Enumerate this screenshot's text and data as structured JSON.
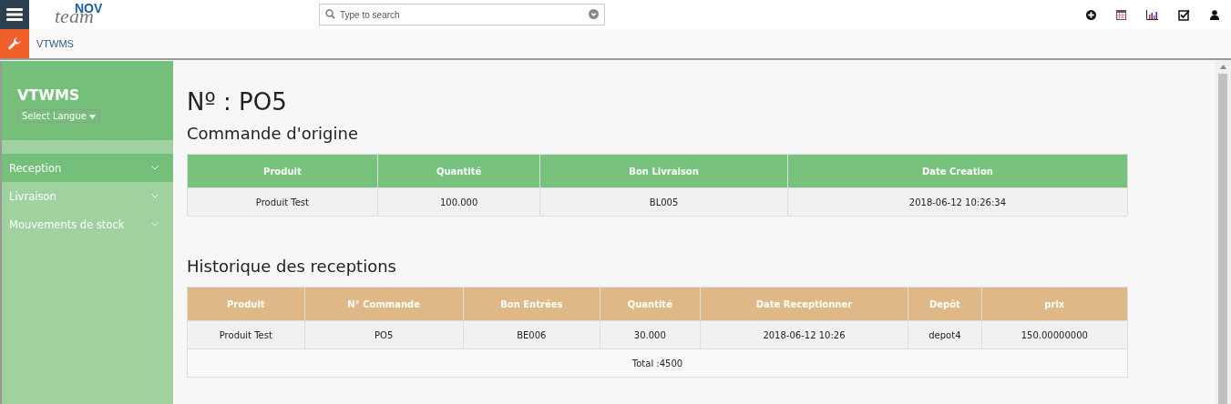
{
  "logo": {
    "top": "NOV",
    "bottom": "team"
  },
  "search": {
    "placeholder": "Type to search"
  },
  "toolbar_icons": [
    {
      "kind": "add"
    },
    {
      "kind": "calendar"
    },
    {
      "kind": "chart"
    },
    {
      "kind": "task"
    },
    {
      "kind": "user"
    }
  ],
  "breadcrumb": "VTWMS",
  "sidebar": {
    "title": "VTWMS",
    "language_select": "Select Langue",
    "items": [
      {
        "label": "Reception",
        "selected": true
      },
      {
        "label": "Livraison",
        "selected": false
      },
      {
        "label": "Mouvements de stock",
        "selected": false
      }
    ]
  },
  "page_title": "Nº : PO5",
  "order": {
    "heading": "Commande d'origine",
    "columns": [
      "Produit",
      "Quantité",
      "Bon Livraison",
      "Date Creation"
    ],
    "rows": [
      [
        "Produit Test",
        "100.000",
        "BL005",
        "2018-06-12 10:26:34"
      ]
    ]
  },
  "receptions": {
    "heading": "Historique des receptions",
    "columns": [
      "Produit",
      "N° Commande",
      "Bon Entrées",
      "Quantité",
      "Date Receptionner",
      "Depôt",
      "prix"
    ],
    "rows": [
      [
        "Produit Test",
        "PO5",
        "BE006",
        "30.000",
        "2018-06-12 10:26",
        "depot4",
        "150.00000000"
      ]
    ],
    "total": "Total :4500"
  }
}
